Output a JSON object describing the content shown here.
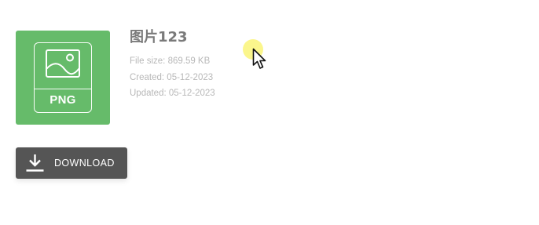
{
  "file": {
    "type_label": "PNG",
    "name": "图片123",
    "size_text": "File size: 869.59 KB",
    "created_text": "Created: 05-12-2023",
    "updated_text": "Updated: 05-12-2023"
  },
  "download_button": {
    "label": "DOWNLOAD"
  },
  "colors": {
    "file_card": "#66bb6a",
    "button": "#555555",
    "title": "#7a7a7a",
    "meta": "#b8b8b8",
    "cursor_highlight": "#faf578"
  },
  "icons": {
    "file_card": "image-icon",
    "button": "download-icon",
    "cursor": "mouse-pointer-icon"
  }
}
